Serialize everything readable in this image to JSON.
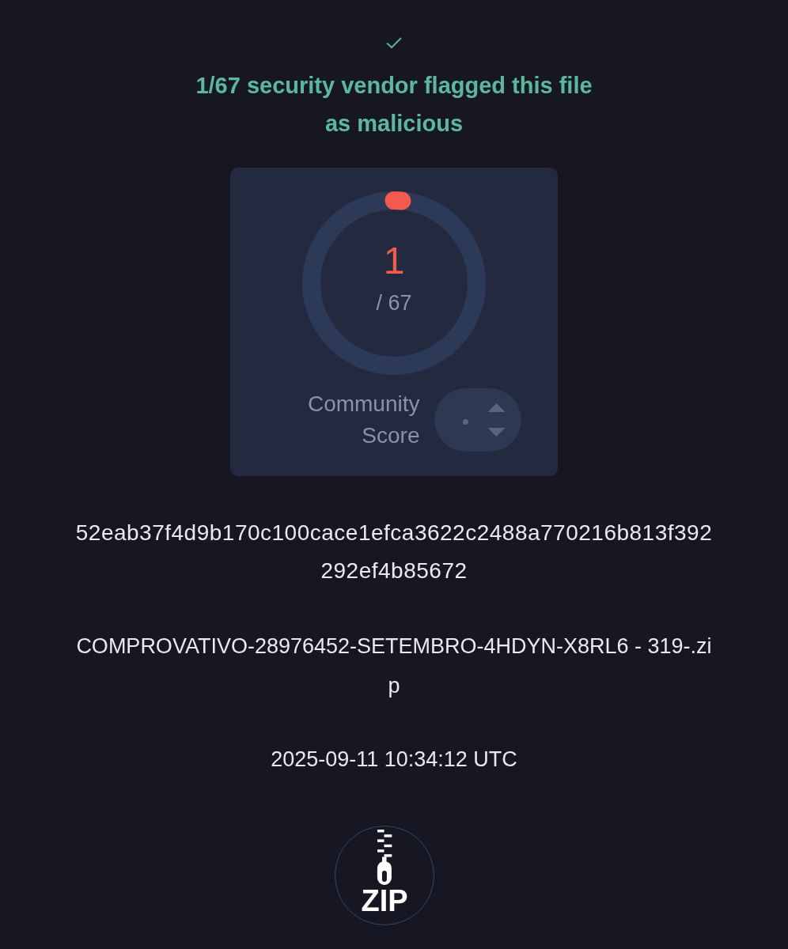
{
  "verdict": {
    "text": "1/67 security vendor flagged this file as malicious"
  },
  "detections": {
    "value": "1",
    "total": "/ 67"
  },
  "community_score": {
    "label": "Community Score"
  },
  "file": {
    "hash": "52eab37f4d9b170c100cace1efca3622c2488a770216b813f392292ef4b85672",
    "name": "COMPROVATIVO-28976452-SETEMBRO-4HDYN-X8RL6 - 319-.zip",
    "date": "2025-09-11 10:34:12 UTC",
    "type_label": "ZIP"
  }
}
